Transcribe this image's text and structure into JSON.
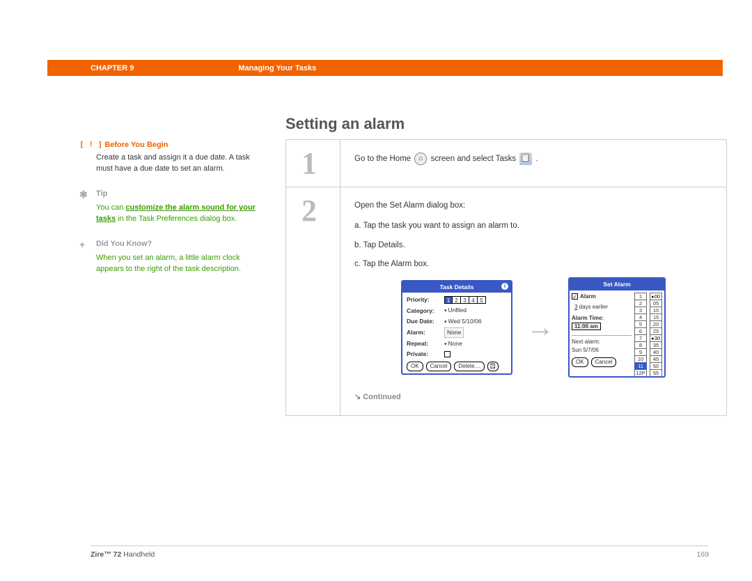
{
  "header": {
    "chapter_label": "CHAPTER 9",
    "section": "Managing Your Tasks"
  },
  "title": "Setting an alarm",
  "sidebar": {
    "before": {
      "title": "Before You Begin",
      "prefix": "[ ! ]",
      "body": "Create a task and assign it a due date. A task must have a due date to set an alarm."
    },
    "tip": {
      "title": "Tip",
      "symbol": "✱",
      "pre": "You can ",
      "link": "customize the alarm sound for your tasks",
      "post": " in the Task Preferences dialog box."
    },
    "dyk": {
      "title": "Did You Know?",
      "symbol": "+",
      "body": "When you set an alarm, a little alarm clock appears to the right of the task description."
    }
  },
  "steps": [
    {
      "num": "1",
      "line": {
        "pre": "Go to the Home ",
        "mid": " screen and select Tasks ",
        "post": "."
      }
    },
    {
      "num": "2",
      "intro": "Open the Set Alarm dialog box:",
      "items": [
        "a.  Tap the task you want to assign an alarm to.",
        "b.  Tap Details.",
        "c.  Tap the Alarm box."
      ],
      "continued": "Continued"
    }
  ],
  "palm1": {
    "title": "Task Details",
    "rows": {
      "priority": "Priority:",
      "priority_vals": [
        "1",
        "2",
        "3",
        "4",
        "5"
      ],
      "priority_sel": "1",
      "category": "Category:",
      "category_v": "Unfiled",
      "duedate": "Due Date:",
      "duedate_v": "Wed 5/10/06",
      "alarm": "Alarm:",
      "alarm_v": "None",
      "repeat": "Repeat:",
      "repeat_v": "None",
      "private": "Private:"
    },
    "buttons": {
      "ok": "OK",
      "cancel": "Cancel",
      "delete": "Delete…",
      "note": "🗒"
    }
  },
  "palm2": {
    "title": "Set Alarm",
    "alarm_lbl": "Alarm",
    "days_num": "3",
    "days_lbl": " days earlier",
    "alarm_time_lbl": "Alarm Time:",
    "alarm_time_v": "11:00 am",
    "next_alarm_lbl": "Next alarm:",
    "next_alarm_v": "Sun 5/7/06",
    "col_h": [
      "1",
      "2",
      "3",
      "4",
      "5",
      "6",
      "7",
      "8",
      "9",
      "10",
      "11",
      "12P"
    ],
    "col_h_sel": "11",
    "col_m": [
      "00",
      "05",
      "10",
      "15",
      "20",
      "25",
      "30",
      "35",
      "40",
      "45",
      "50",
      "55"
    ],
    "col_m_marks": [
      "00",
      "30"
    ],
    "buttons": {
      "ok": "OK",
      "cancel": "Cancel"
    }
  },
  "footer": {
    "product_bold": "Zire™ 72",
    "product_rest": " Handheld",
    "page": "169"
  }
}
